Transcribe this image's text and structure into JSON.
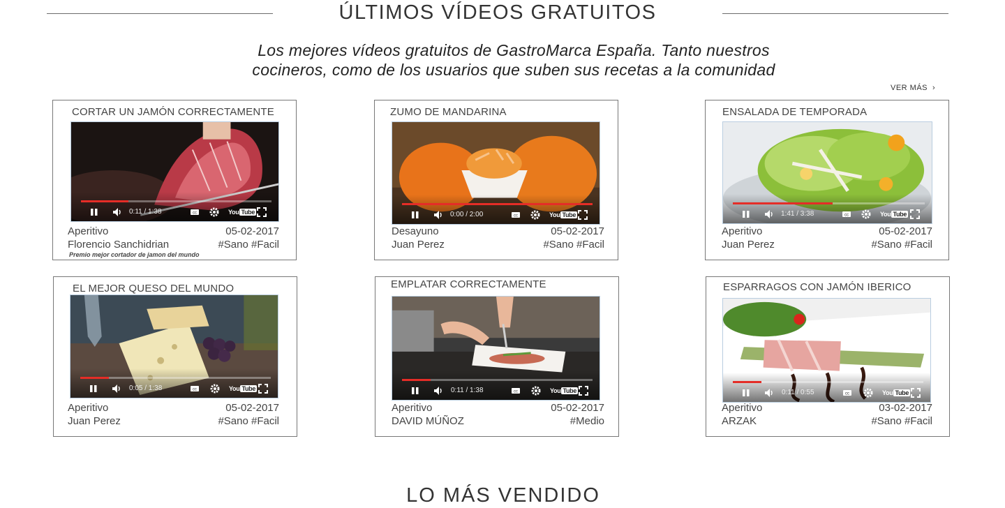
{
  "section": {
    "title": "ÚLTIMOS VÍDEOS GRATUITOS",
    "subtitle_line1": "Los mejores vídeos gratuitos de GastroMarca España. Tanto nuestros",
    "subtitle_line2": "cocineros, como de los usuarios que suben sus recetas a la comunidad",
    "see_more": "VER MÁS"
  },
  "videos": [
    {
      "title": "CORTAR UN JAMÓN CORRECTAMENTE",
      "category": "Aperitivo",
      "date": "05-02-2017",
      "author": "Florencio Sanchidrian",
      "tags": "#Sano #Facil",
      "note": "Premio mejor cortador de jamon del mundo",
      "time": "0:11 / 1:38",
      "progress": 0.25
    },
    {
      "title": "ZUMO DE MANDARINA",
      "category": "Desayuno",
      "date": "05-02-2017",
      "author": "Juan Perez",
      "tags": "#Sano #Facil",
      "time": "0:00 / 2:00",
      "progress": 1.0
    },
    {
      "title": "ENSALADA DE TEMPORADA",
      "category": "Aperitivo",
      "date": "05-02-2017",
      "author": "Juan Perez",
      "tags": "#Sano #Facil",
      "time": "1:41 / 3:38",
      "progress": 0.52
    },
    {
      "title": "EL MEJOR QUESO DEL MUNDO",
      "category": "Aperitivo",
      "date": "05-02-2017",
      "author": "Juan Perez",
      "tags": "#Sano #Facil",
      "time": "0:05 / 1:38",
      "progress": 0.15
    },
    {
      "title": "EMPLATAR CORRECTAMENTE",
      "category": "Aperitivo",
      "date": "05-02-2017",
      "author": "DAVID MÚÑOZ",
      "tags": "#Medio",
      "time": "0:11 / 1:38",
      "progress": 0.15
    },
    {
      "title": "ESPARRAGOS CON JAMÓN IBERICO",
      "category": "Aperitivo",
      "date": "03-02-2017",
      "author": "ARZAK",
      "tags": "#Sano #Facil",
      "time": "0:11 / 0:55",
      "progress": 0.15
    }
  ],
  "player": {
    "youtube_label": "You",
    "youtube_tube": "Tube",
    "accent": "#e52d27"
  },
  "next_section": {
    "title": "LO MÁS VENDIDO"
  }
}
